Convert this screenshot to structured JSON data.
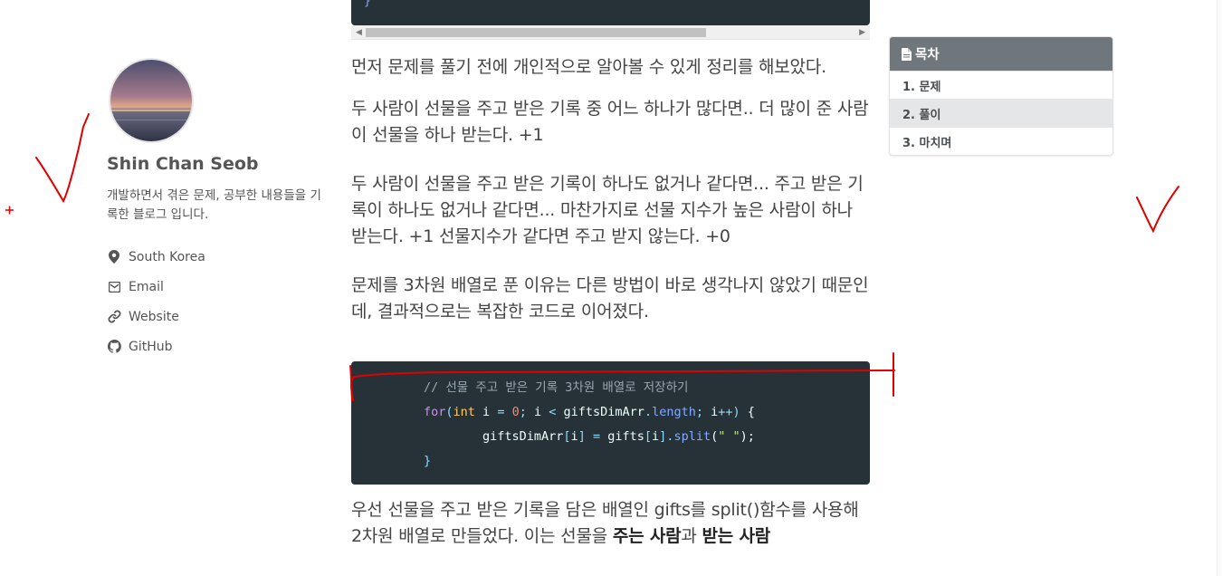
{
  "author": {
    "name": "Shin Chan Seob",
    "bio": "개발하면서 겪은 문제, 공부한 내용들을 기록한 블로그 입니다.",
    "links": [
      {
        "label": "South Korea",
        "icon": "location-pin-icon"
      },
      {
        "label": "Email",
        "icon": "envelope-icon"
      },
      {
        "label": "Website",
        "icon": "link-icon"
      },
      {
        "label": "GitHub",
        "icon": "github-icon"
      }
    ]
  },
  "content": {
    "paragraphs": [
      "먼저 문제를 풀기 전에 개인적으로 알아볼 수 있게 정리를 해보았다.",
      "두 사람이 선물을 주고 받은 기록 중 어느 하나가 많다면.. 더 많이 준 사람이 선물을 하나 받는다. +1",
      "두 사람이 선물을 주고 받은 기록이 하나도 없거나 같다면... 주고 받은 기록이 하나도 없거나 같다면... 마찬가지로 선물 지수가 높은 사람이 하나 받는다. +1 선물지수가 같다면 주고 받지 않는다. +0",
      "문제를 3차원 배열로 푼 이유는 다른 방법이 바로 생각나지 않았기 때문인데, 결과적으로는 복잡한 코드로 이어졌다."
    ],
    "code_top_char": "}",
    "code": {
      "line1": "// 선물 주고 받은 기록 3차원 배열로 저장하기",
      "line2": "for(int i = 0; i < giftsDimArr.length; i++) {",
      "line3": "giftsDimArr[i] = gifts[i].split(\" \");",
      "line4": "}"
    },
    "last_paragraph": {
      "part1": "우선 선물을 주고 받은 기록을 담은 배열인 gifts를 split()함수를 사용해 2차원 배열로 만들었다. 이는 선물을 ",
      "bold1": "주는 사람",
      "part2": "과 ",
      "bold2": "받는 사람"
    }
  },
  "toc": {
    "title": "목차",
    "items": [
      {
        "label": "1. 문제",
        "active": false
      },
      {
        "label": "2. 풀이",
        "active": true
      },
      {
        "label": "3. 마치며",
        "active": false
      }
    ]
  },
  "colors": {
    "code_bg": "#263238",
    "toc_header_bg": "#6f777d",
    "toc_active_bg": "#e5e6e7",
    "annotation_red": "#e00000"
  }
}
